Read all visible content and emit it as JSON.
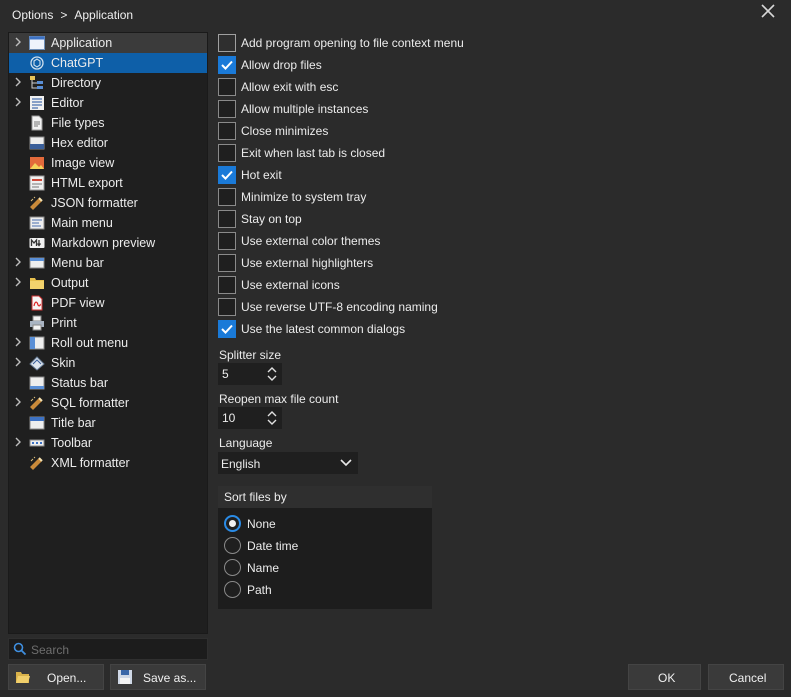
{
  "breadcrumb": {
    "root": "Options",
    "separator": ">",
    "current": "Application"
  },
  "window": {
    "close_icon": "close-icon"
  },
  "tree": {
    "items": [
      {
        "label": "Application",
        "expandable": true,
        "icon": "window-icon",
        "state": "selected"
      },
      {
        "label": "ChatGPT",
        "expandable": false,
        "icon": "chatgpt-icon",
        "state": "highlight"
      },
      {
        "label": "Directory",
        "expandable": true,
        "icon": "directory-tree-icon",
        "state": ""
      },
      {
        "label": "Editor",
        "expandable": true,
        "icon": "editor-icon",
        "state": ""
      },
      {
        "label": "File types",
        "expandable": false,
        "icon": "file-types-icon",
        "state": ""
      },
      {
        "label": "Hex editor",
        "expandable": false,
        "icon": "hex-icon",
        "state": ""
      },
      {
        "label": "Image view",
        "expandable": false,
        "icon": "image-icon",
        "state": ""
      },
      {
        "label": "HTML export",
        "expandable": false,
        "icon": "html-icon",
        "state": ""
      },
      {
        "label": "JSON formatter",
        "expandable": false,
        "icon": "formatter-icon",
        "state": ""
      },
      {
        "label": "Main menu",
        "expandable": false,
        "icon": "menu-icon",
        "state": ""
      },
      {
        "label": "Markdown preview",
        "expandable": false,
        "icon": "markdown-icon",
        "state": ""
      },
      {
        "label": "Menu bar",
        "expandable": true,
        "icon": "menubar-icon",
        "state": ""
      },
      {
        "label": "Output",
        "expandable": true,
        "icon": "folder-icon",
        "state": ""
      },
      {
        "label": "PDF view",
        "expandable": false,
        "icon": "pdf-icon",
        "state": ""
      },
      {
        "label": "Print",
        "expandable": false,
        "icon": "printer-icon",
        "state": ""
      },
      {
        "label": "Roll out menu",
        "expandable": true,
        "icon": "rollout-icon",
        "state": ""
      },
      {
        "label": "Skin",
        "expandable": true,
        "icon": "skin-icon",
        "state": ""
      },
      {
        "label": "Status bar",
        "expandable": false,
        "icon": "statusbar-icon",
        "state": ""
      },
      {
        "label": "SQL formatter",
        "expandable": true,
        "icon": "formatter-icon",
        "state": ""
      },
      {
        "label": "Title bar",
        "expandable": false,
        "icon": "titlebar-icon",
        "state": ""
      },
      {
        "label": "Toolbar",
        "expandable": true,
        "icon": "toolbar-icon",
        "state": ""
      },
      {
        "label": "XML formatter",
        "expandable": false,
        "icon": "formatter-icon",
        "state": ""
      }
    ]
  },
  "search": {
    "placeholder": "Search"
  },
  "buttons": {
    "open": "Open...",
    "save_as": "Save as...",
    "ok": "OK",
    "cancel": "Cancel"
  },
  "options": [
    {
      "label": "Add program opening to file context menu",
      "checked": false
    },
    {
      "label": "Allow drop files",
      "checked": true
    },
    {
      "label": "Allow exit with esc",
      "checked": false
    },
    {
      "label": "Allow multiple instances",
      "checked": false
    },
    {
      "label": "Close minimizes",
      "checked": false
    },
    {
      "label": "Exit when last tab is closed",
      "checked": false
    },
    {
      "label": "Hot exit",
      "checked": true
    },
    {
      "label": "Minimize to system tray",
      "checked": false
    },
    {
      "label": "Stay on top",
      "checked": false
    },
    {
      "label": "Use external color themes",
      "checked": false
    },
    {
      "label": "Use external highlighters",
      "checked": false
    },
    {
      "label": "Use external icons",
      "checked": false
    },
    {
      "label": "Use reverse UTF-8 encoding naming",
      "checked": false
    },
    {
      "label": "Use the latest common dialogs",
      "checked": true
    }
  ],
  "splitter": {
    "label": "Splitter size",
    "value": "5"
  },
  "reopen": {
    "label": "Reopen max file count",
    "value": "10"
  },
  "language": {
    "label": "Language",
    "value": "English"
  },
  "sort": {
    "title": "Sort files by",
    "options": [
      {
        "label": "None",
        "selected": true
      },
      {
        "label": "Date time",
        "selected": false
      },
      {
        "label": "Name",
        "selected": false
      },
      {
        "label": "Path",
        "selected": false
      }
    ]
  },
  "colors": {
    "accent": "#1a7ad8",
    "selection": "#0e5fa8",
    "background": "#2b2b2b",
    "panel": "#1f1f1f"
  }
}
